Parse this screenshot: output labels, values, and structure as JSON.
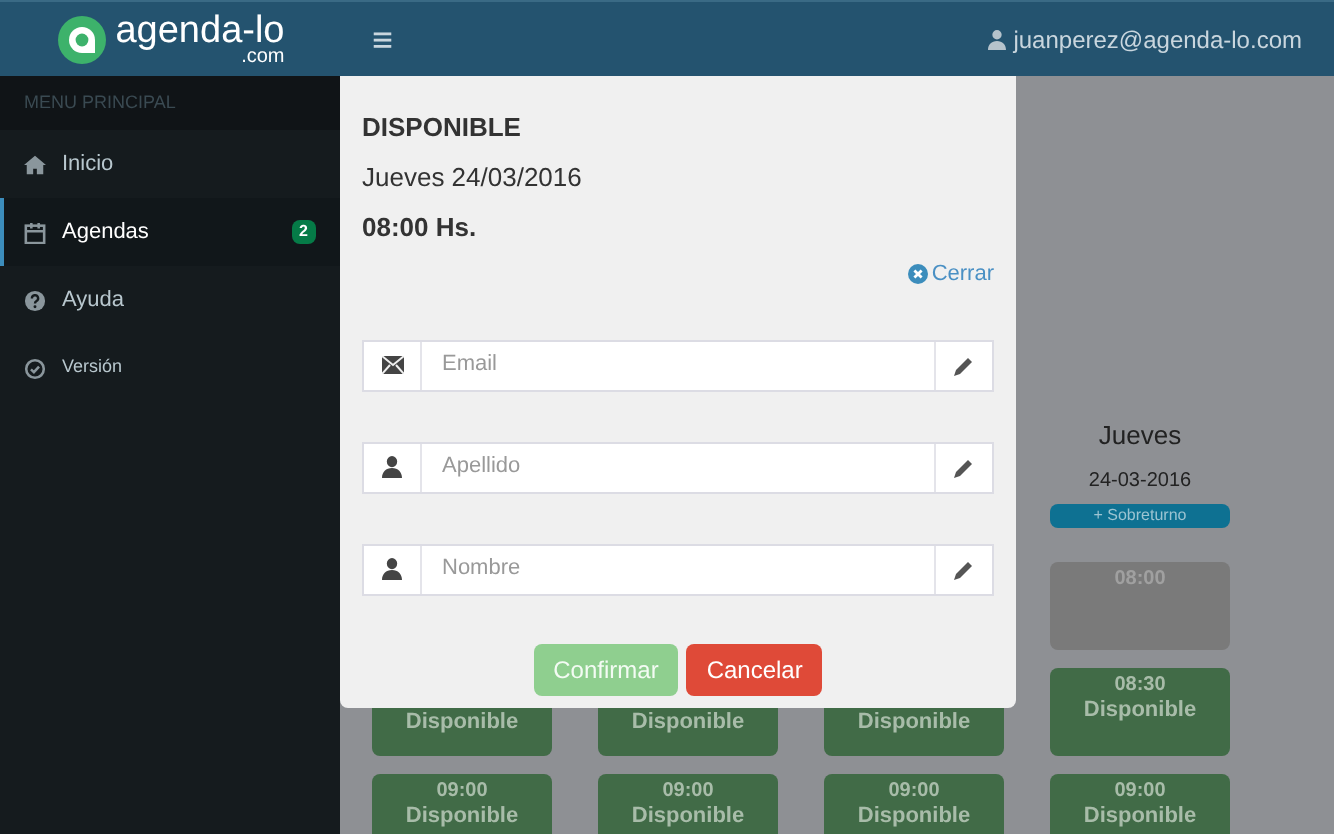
{
  "header": {
    "logo": {
      "name": "agenda-lo",
      "suffix": ".com"
    },
    "menu_icon": "≡",
    "user": "juanperez@agenda-lo.com"
  },
  "sidebar": {
    "heading": "MENU PRINCIPAL",
    "items": [
      {
        "label": "Inicio",
        "selected": false
      },
      {
        "label": "Agendas",
        "selected": true,
        "badge": "2"
      },
      {
        "label": "Ayuda",
        "selected": false
      },
      {
        "label": "Versión",
        "selected": false
      }
    ]
  },
  "schedule": {
    "columns": [
      {
        "slots": [
          {
            "status": "Disponible"
          },
          {
            "time": "09:00",
            "status": "Disponible"
          }
        ]
      },
      {
        "slots": [
          {
            "status": "Disponible"
          },
          {
            "time": "09:00",
            "status": "Disponible"
          }
        ]
      },
      {
        "slots": [
          {
            "status": "Disponible"
          },
          {
            "time": "09:00",
            "status": "Disponible"
          }
        ]
      },
      {
        "day": "Jueves",
        "date": "24-03-2016",
        "button": "+ Sobreturno",
        "slots": [
          {
            "time": "08:00",
            "kind": "taken"
          },
          {
            "time": "08:30",
            "status": "Disponible"
          },
          {
            "time": "09:00",
            "status": "Disponible"
          }
        ]
      }
    ]
  },
  "modal": {
    "title": "DISPONIBLE",
    "date": "Jueves 24/03/2016",
    "time": "08:00 Hs.",
    "close": "Cerrar",
    "fields": [
      {
        "placeholder": "Email"
      },
      {
        "placeholder": "Apellido"
      },
      {
        "placeholder": "Nombre"
      }
    ],
    "buttons": [
      {
        "label": "Confirmar",
        "kind": "confirm"
      },
      {
        "label": "Cancelar",
        "kind": "cancel"
      }
    ]
  }
}
